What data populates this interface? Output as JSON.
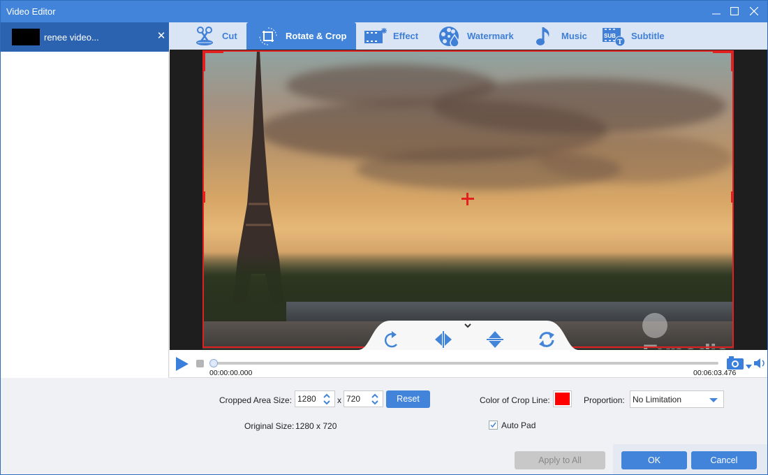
{
  "window": {
    "title": "Video Editor",
    "controls": [
      "minimize",
      "maximize",
      "close"
    ]
  },
  "sidebar": {
    "files": [
      {
        "name": "renee video...",
        "selected": true
      }
    ]
  },
  "tabs": [
    {
      "id": "cut",
      "label": "Cut",
      "icon": "scissors-icon",
      "active": false
    },
    {
      "id": "rotate-crop",
      "label": "Rotate & Crop",
      "icon": "crop-rotate-icon",
      "active": true
    },
    {
      "id": "effect",
      "label": "Effect",
      "icon": "film-sparkle-icon",
      "active": false
    },
    {
      "id": "watermark",
      "label": "Watermark",
      "icon": "film-reel-drop-icon",
      "active": false
    },
    {
      "id": "music",
      "label": "Music",
      "icon": "music-note-icon",
      "active": false
    },
    {
      "id": "subtitle",
      "label": "Subtitle",
      "icon": "subtitle-icon",
      "active": false
    }
  ],
  "preview": {
    "watermark_text": "Expedia",
    "crop_line_color": "#e22020",
    "tools": [
      {
        "id": "rotate",
        "icon": "rotate-clockwise-icon"
      },
      {
        "id": "flip-horizontal",
        "icon": "flip-horizontal-icon"
      },
      {
        "id": "flip-vertical",
        "icon": "flip-vertical-icon"
      },
      {
        "id": "reset-rotation",
        "icon": "refresh-icon"
      }
    ]
  },
  "player": {
    "current_time": "00:00:00.000",
    "total_time": "00:06:03.476",
    "progress": 0
  },
  "settings": {
    "cropped_area_label": "Cropped Area Size:",
    "crop_width": "1280",
    "crop_height": "720",
    "times_sign": "x",
    "reset_label": "Reset",
    "original_size_label": "Original Size:",
    "original_size_value": "1280 x 720",
    "crop_line_color_label": "Color of Crop Line:",
    "crop_line_color": "#ff0000",
    "proportion_label": "Proportion:",
    "proportion_value": "No Limitation",
    "auto_pad_label": "Auto Pad",
    "auto_pad_checked": true
  },
  "footer": {
    "apply_all_label": "Apply to All",
    "ok_label": "OK",
    "cancel_label": "Cancel"
  },
  "colors": {
    "accent": "#4184da",
    "titlebar": "#4184da",
    "sidebar_selected": "#2c63b0",
    "tab_bar": "#d9e5f5"
  }
}
